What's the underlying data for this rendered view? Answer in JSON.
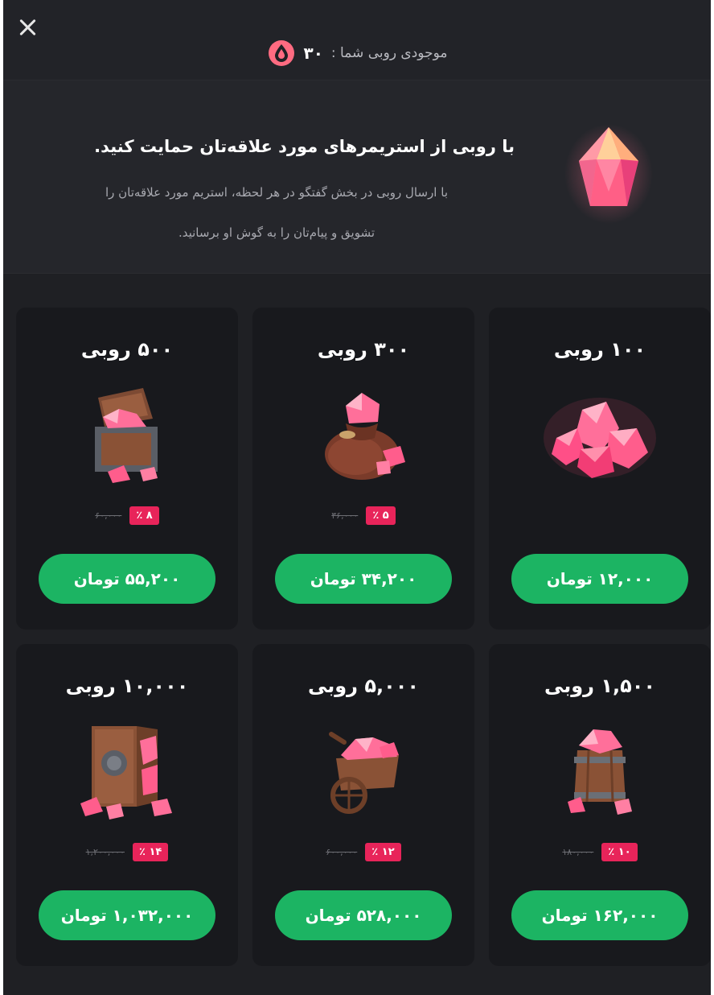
{
  "header": {
    "balance_label": "موجودی روبی شما :",
    "balance_value": "۳۰"
  },
  "hero": {
    "title": "با روبی از استریمرهای مورد علاقه‌تان حمایت کنید.",
    "desc_line1": "با ارسال روبی در بخش گفتگو در هر لحظه، استریم مورد علاقه‌تان را",
    "desc_line2": "تشویق و پیام‌تان را به گوش او برسانید."
  },
  "packages": [
    {
      "title": "۱۰۰ روبی",
      "price": "۱۲,۰۰۰ تومان",
      "old_price": "",
      "discount": "",
      "art": "gems-cluster-icon"
    },
    {
      "title": "۳۰۰ روبی",
      "price": "۳۴,۲۰۰ تومان",
      "old_price": "۳۶,۰۰۰",
      "discount": "۵ ٪",
      "art": "gem-sack-icon"
    },
    {
      "title": "۵۰۰ روبی",
      "price": "۵۵,۲۰۰ تومان",
      "old_price": "۶۰,۰۰۰",
      "discount": "۸ ٪",
      "art": "treasure-chest-icon"
    },
    {
      "title": "۱,۵۰۰ روبی",
      "price": "۱۶۲,۰۰۰ تومان",
      "old_price": "۱۸۰,۰۰۰",
      "discount": "۱۰ ٪",
      "art": "gem-barrel-icon"
    },
    {
      "title": "۵,۰۰۰ روبی",
      "price": "۵۲۸,۰۰۰ تومان",
      "old_price": "۶۰۰,۰۰۰",
      "discount": "۱۲ ٪",
      "art": "gem-cart-icon"
    },
    {
      "title": "۱۰,۰۰۰ روبی",
      "price": "۱,۰۳۲,۰۰۰ تومان",
      "old_price": "۱,۲۰۰,۰۰۰",
      "discount": "۱۴ ٪",
      "art": "gem-vault-icon"
    }
  ],
  "colors": {
    "background": "#1f2024",
    "card": "#18191d",
    "accent_green": "#1cb463",
    "badge_pink": "#e8245a",
    "ruby": "#ff5a7a"
  }
}
